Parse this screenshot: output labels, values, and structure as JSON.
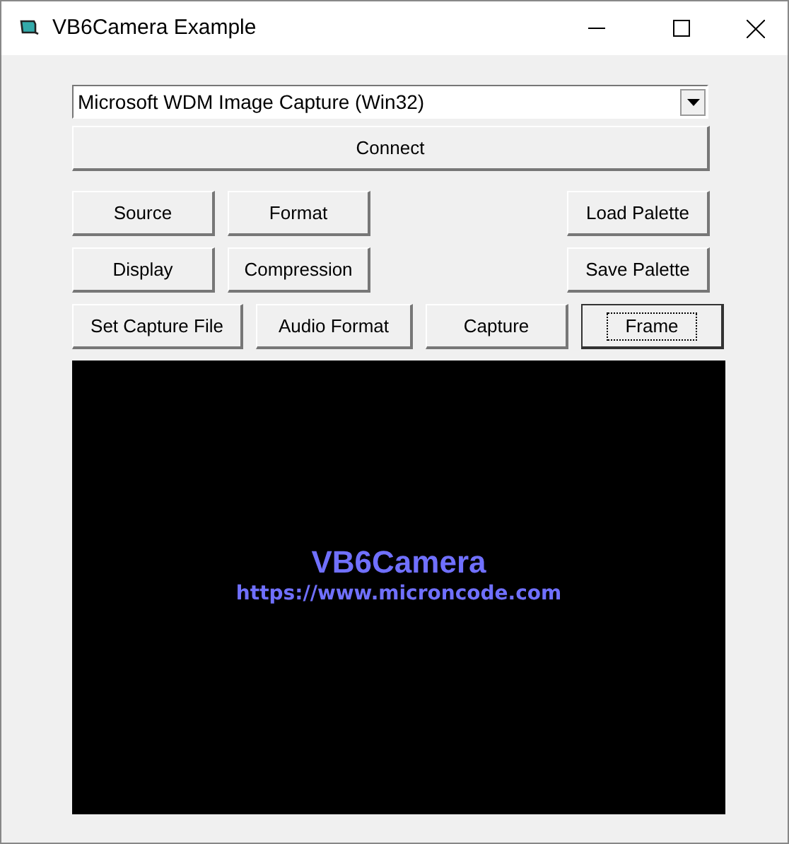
{
  "window": {
    "title": "VB6Camera Example"
  },
  "device_select": {
    "value": "Microsoft WDM Image Capture (Win32)"
  },
  "connect_button": {
    "label": "Connect",
    "focused": false
  },
  "button_rows": [
    [
      {
        "label": "Source",
        "focused": false
      },
      {
        "label": "Format",
        "focused": false
      },
      {
        "label": "Load Palette",
        "focused": false
      }
    ],
    [
      {
        "label": "Display",
        "focused": false
      },
      {
        "label": "Compression",
        "focused": false
      },
      {
        "label": "Save Palette",
        "focused": false
      }
    ],
    [
      {
        "label": "Set Capture File",
        "focused": false
      },
      {
        "label": "Audio Format",
        "focused": false
      },
      {
        "label": "Capture",
        "focused": false
      },
      {
        "label": "Frame",
        "focused": true
      }
    ]
  ],
  "preview": {
    "title": "VB6Camera",
    "url": "https://www.microncode.com"
  }
}
